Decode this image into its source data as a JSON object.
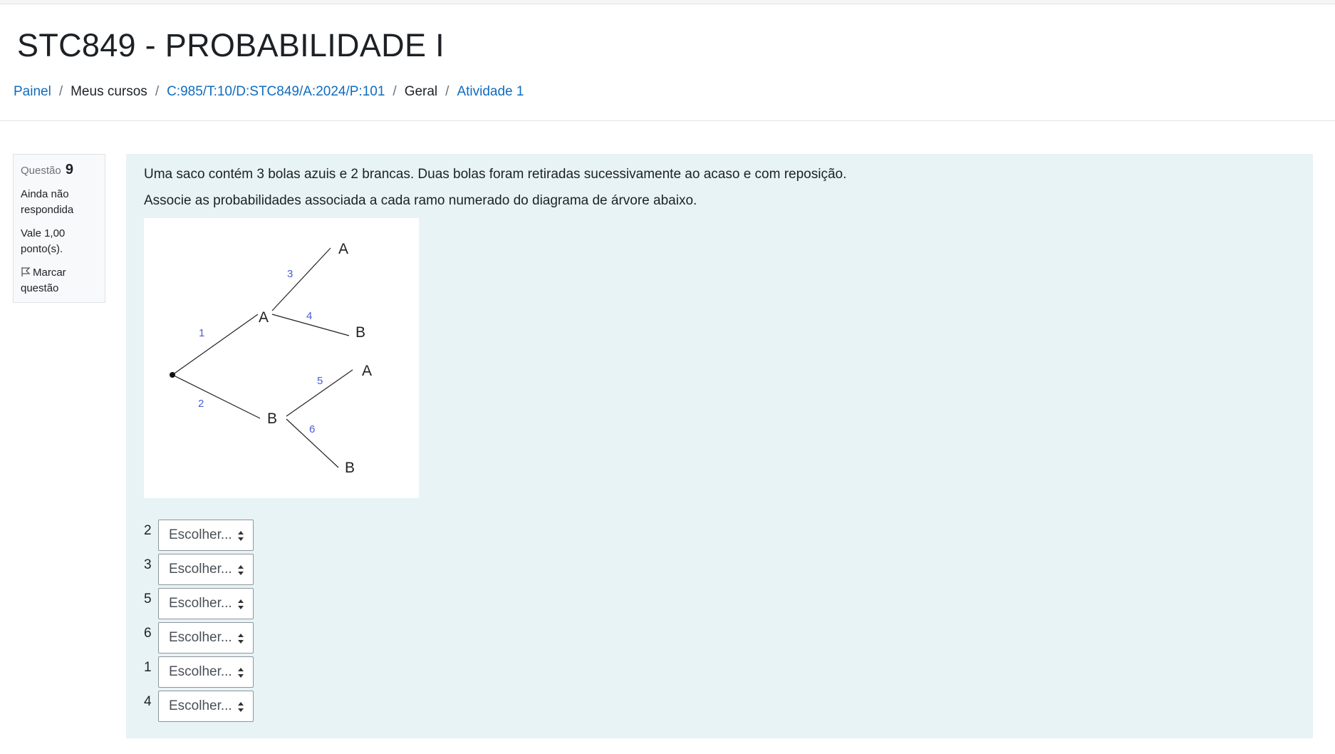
{
  "header": {
    "title": "STC849 - PROBABILIDADE I",
    "breadcrumb": [
      {
        "label": "Painel",
        "link": true
      },
      {
        "label": "Meus cursos",
        "link": false
      },
      {
        "label": "C:985/T:10/D:STC849/A:2024/P:101",
        "link": true
      },
      {
        "label": "Geral",
        "link": false
      },
      {
        "label": "Atividade 1",
        "link": true
      }
    ],
    "separator": "/"
  },
  "question_info": {
    "label": "Questão",
    "number": "9",
    "state": "Ainda não respondida",
    "grade": "Vale 1,00 ponto(s).",
    "flag_label": "Marcar questão",
    "flag_icon": "flag-icon"
  },
  "question": {
    "text1": "Uma saco contém 3 bolas azuis e 2 brancas. Duas bolas foram retiradas sucessivamente ao acaso e com reposição.",
    "text2": "Associe as probabilidades associada a cada ramo numerado do diagrama de árvore abaixo.",
    "diagram": {
      "node_labels": {
        "a1": "A",
        "a2": "A",
        "b1": "B",
        "b2": "B",
        "a3": "A",
        "b3": "B"
      },
      "branch_labels": [
        "1",
        "2",
        "3",
        "4",
        "5",
        "6"
      ],
      "branch_label_color": "#4b5bd6"
    },
    "answers": [
      {
        "number": "2",
        "select": "Escolher..."
      },
      {
        "number": "3",
        "select": "Escolher..."
      },
      {
        "number": "5",
        "select": "Escolher..."
      },
      {
        "number": "6",
        "select": "Escolher..."
      },
      {
        "number": "1",
        "select": "Escolher..."
      },
      {
        "number": "4",
        "select": "Escolher..."
      }
    ]
  },
  "colors": {
    "link": "#0f6cbf",
    "content_bg": "#e7f3f5",
    "info_bg": "#f8f9fa"
  }
}
